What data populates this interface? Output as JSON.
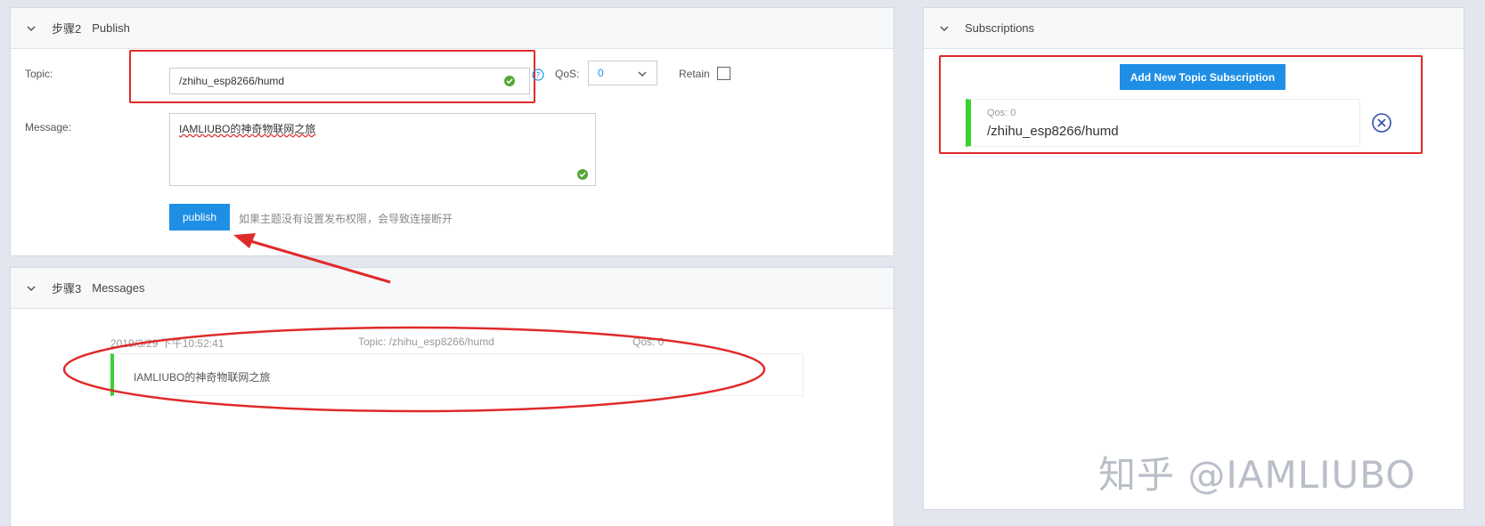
{
  "publish": {
    "header": {
      "step": "步骤2",
      "title": "Publish"
    },
    "topic_label": "Topic:",
    "topic_value": "/zhihu_esp8266/humd",
    "qos_label": "QoS:",
    "qos_value": "0",
    "retain_label": "Retain",
    "message_label": "Message:",
    "message_value": "IAMLIUBO的神奇物联网之旅",
    "publish_button": "publish",
    "hint": "如果主题没有设置发布权限，会导致连接断开"
  },
  "messages": {
    "header": {
      "step": "步骤3",
      "title": "Messages"
    },
    "items": [
      {
        "timestamp": "2019/3/29 下午10:52:41",
        "topic": "Topic: /zhihu_esp8266/humd",
        "qos": "Qos: 0",
        "content": "IAMLIUBO的神奇物联网之旅"
      }
    ]
  },
  "subscriptions": {
    "header": {
      "title": "Subscriptions"
    },
    "add_button": "Add New Topic Subscription",
    "items": [
      {
        "qos": "Qos: 0",
        "topic": "/zhihu_esp8266/humd"
      }
    ]
  },
  "watermark": "知乎 @IAMLIUBO",
  "colors": {
    "accent": "#1f8fe6",
    "annotation_red": "#e02a2a",
    "success_green": "#52a834",
    "card_bar_green": "#3ad12d"
  }
}
